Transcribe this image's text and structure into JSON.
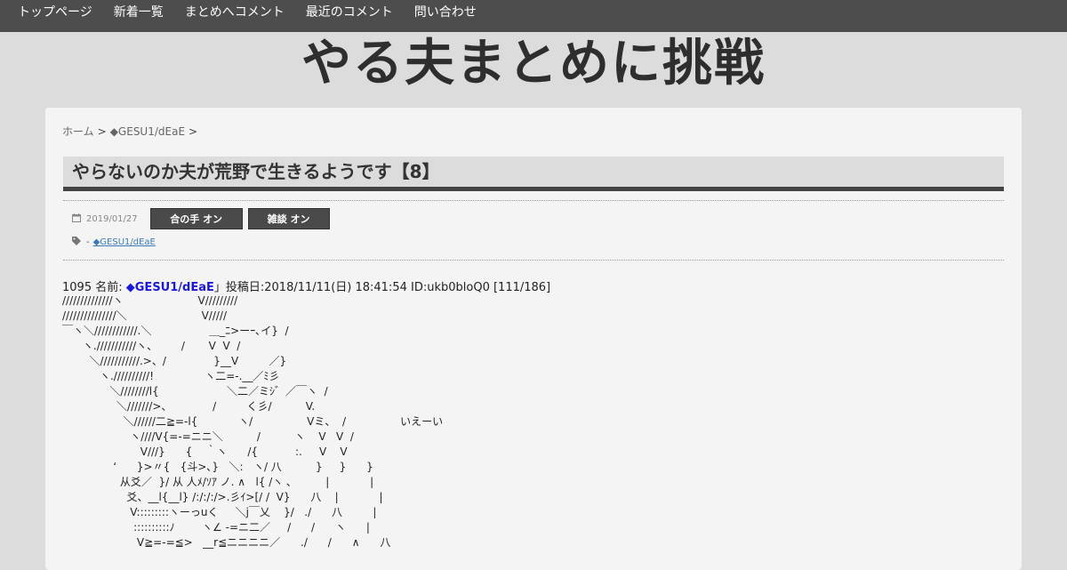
{
  "nav": {
    "items": [
      "トップページ",
      "新着一覧",
      "まとめへコメント",
      "最近のコメント",
      "問い合わせ"
    ]
  },
  "site_title": "やる夫まとめに挑戦",
  "breadcrumb": {
    "home": "ホーム",
    "category": "◆GESU1/dEaE",
    "separator": ">"
  },
  "post": {
    "title": "やらないのか夫が荒野で生きるようです【8】",
    "date": "2019/01/27",
    "toggle_ainote": "合の手 オン",
    "toggle_chat": "雑談 オン",
    "tag_prefix": "-",
    "tag": "◆GESU1/dEaE"
  },
  "response": {
    "number": "1095",
    "name_label": "名前:",
    "name": "◆GESU1/dEaE",
    "post_date_label": "」投稿日:",
    "post_date": "2018/11/11(日) 18:41:54",
    "id": "ID:ukb0bloQ0",
    "count": "[111/186]",
    "aa": "//////////////ヽ                      V/////////\n///////////////＼                      V/////\n￣ヽ＼////////////.＼                 ＿_ﾆ>ーｰ､イ}  /\n      ヽ.///////////ヽ、       /       V  V  /\n        ＼///////////.>、/              }__V         ／}\n           ヽ.//////////!               ヽ二=-.__／ﾐ彡\n              ＼////////l{                    ＼二／ミｼ゛／￣ヽ  /\n                ＼///////>、            /         く彡/          V.\n                  ＼//////二≧=-l{            ヽ/                Vミ、  /                いえーい\n                    ヽ////V{=-=ニニ＼          /          ヽ    V   V  /\n                       V///}      {    ｀ヽ      /{           :.     V    V\n               ‘      }>〃{   {斗>､}   ＼:   ヽ/ 八          }     }      }\n                 从爻／  }/ 从 人ﾒ/ｿｱ ノ. ∧   l{ /ヽ ､          |            |\n                   爻、__l{__l} /:/:/:/>.彡ｲ>[/ /  V}      八    |            |\n                    V:::::::::ヽーっuく     ＼j￣乂    }/   ./      八         |\n                     ::::::::::ﾉ        ヽ∠ -=ニ二／     /      /      ヽ      |\n                      V≧=-=≦>   __r≦ニニニニ／      ./      /      ∧      八"
  }
}
